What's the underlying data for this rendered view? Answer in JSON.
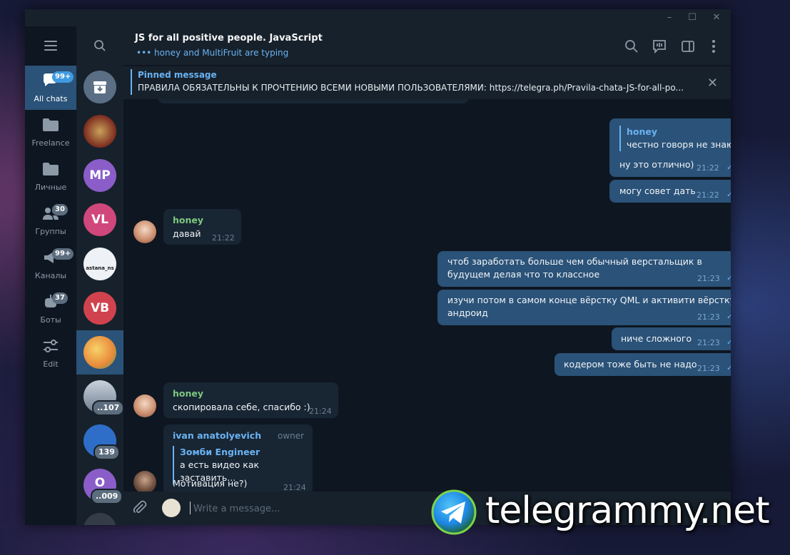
{
  "app": {
    "colors": {
      "accent": "#6ab3f3",
      "selected": "#2b5278",
      "bg": "#0e1621",
      "panel": "#17212b"
    }
  },
  "folders": [
    {
      "label": "All chats",
      "badge": "99+",
      "icon": "chat-bubbles-icon"
    },
    {
      "label": "Freelance",
      "badge": "",
      "icon": "folder-icon"
    },
    {
      "label": "Личные",
      "badge": "",
      "icon": "folder-icon"
    },
    {
      "label": "Группы",
      "badge": "30",
      "icon": "group-icon"
    },
    {
      "label": "Каналы",
      "badge": "99+",
      "icon": "channel-icon"
    },
    {
      "label": "Боты",
      "badge": "37",
      "icon": "bot-icon"
    },
    {
      "label": "Edit",
      "badge": "",
      "icon": "sliders-icon"
    }
  ],
  "chatlist": {
    "avatars": [
      {
        "initials": "",
        "color": "#bd9a5a"
      },
      {
        "initials": "MP",
        "color": "#8a5dc9"
      },
      {
        "initials": "VL",
        "color": "#d0477c"
      },
      {
        "initials": "",
        "color": "#e8eef5"
      },
      {
        "initials": "VB",
        "color": "#d0434e"
      },
      {
        "initials": "",
        "color": "#f0a64a"
      },
      {
        "initials": "",
        "color": "#9aa7b5"
      },
      {
        "initials": "",
        "color": "#3a7fd6"
      },
      {
        "initials": "O",
        "color": "#8a5dc9"
      }
    ],
    "badges": {
      "b1": "..107",
      "b2": "139",
      "b3": "..009"
    },
    "avatar_texts": {
      "astana": "astana_ns"
    }
  },
  "header": {
    "title": "JS for all positive people. JavaScript",
    "typing": "••• honey and MultiFruit are typing"
  },
  "pinned": {
    "title": "Pinned message",
    "text": "ПРАВИЛА ОБЯЗАТЕЛЬНЫ К ПРОЧТЕНИЮ ВСЕМИ НОВЫМИ ПОЛЬЗОВАТЕЛЯМИ: https://telegra.ph/Pravila-chata-JS-for-all-po..."
  },
  "messages": {
    "m1": {
      "reply_name": "honey",
      "reply_text": "честно говоря не знаю...",
      "text": "ну это отлично)",
      "time": "21:22"
    },
    "m2": {
      "text": "могу совет дать",
      "time": "21:22"
    },
    "m3": {
      "sender": "honey",
      "text": "давай",
      "time": "21:22"
    },
    "m4": {
      "line1": "чтоб заработать больше чем обычный верстальщик в",
      "line2": "будущем делая что то классное",
      "time": "21:23"
    },
    "m5": {
      "line1": "изучи потом в самом конце вёрстку QML и активити вёрстку",
      "line2": "андроид",
      "time": "21:23"
    },
    "m6": {
      "text": "ниче сложного",
      "time": "21:23"
    },
    "m7": {
      "text": "кодером тоже быть не надо",
      "time": "21:23"
    },
    "m8": {
      "sender": "honey",
      "text": "скопировала себе, спасибо :)",
      "time": "21:24"
    },
    "m9": {
      "sender": "ivan anatolyevich",
      "role": "owner",
      "reply_name": "Зомби Engineer",
      "reply_text": "а есть видео как заставить...",
      "text": "Мотивация не?)",
      "time": "21:24"
    }
  },
  "composer": {
    "placeholder": "Write a message..."
  },
  "watermark": {
    "text": "telegrammy.net"
  }
}
